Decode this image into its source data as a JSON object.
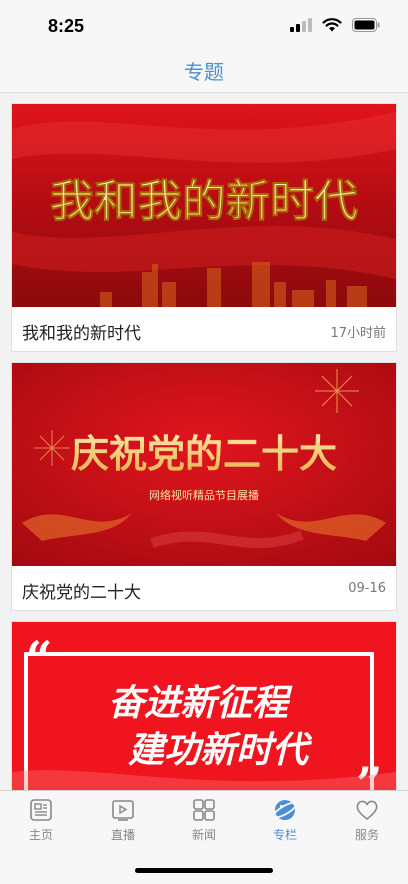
{
  "status": {
    "time": "8:25"
  },
  "nav": {
    "title": "专题"
  },
  "cards": [
    {
      "banner_text": "我和我的新时代",
      "title": "我和我的新时代",
      "time": "17小时前"
    },
    {
      "banner_text": "庆祝党的二十大",
      "banner_subtext": "网络视听精品节目展播",
      "title": "庆祝党的二十大",
      "time": "09-16"
    },
    {
      "banner_line1": "奋进新征程",
      "banner_line2": "建功新时代"
    }
  ],
  "tabs": [
    {
      "label": "主页",
      "icon": "home-newspaper-icon"
    },
    {
      "label": "直播",
      "icon": "live-video-icon"
    },
    {
      "label": "新闻",
      "icon": "news-grid-icon"
    },
    {
      "label": "专栏",
      "icon": "column-planet-icon",
      "active": true
    },
    {
      "label": "服务",
      "icon": "service-heart-icon"
    }
  ],
  "colors": {
    "accent": "#4a8fd6",
    "banner_red": "#c8101a"
  }
}
